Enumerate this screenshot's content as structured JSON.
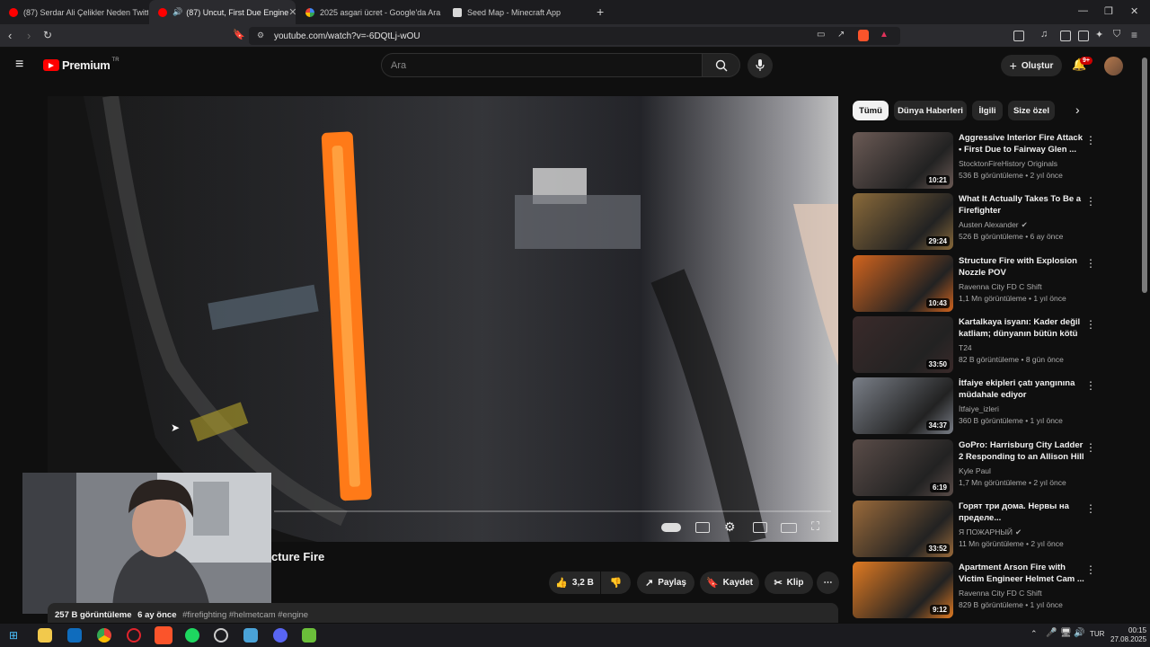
{
  "browser": {
    "tabs": [
      {
        "label": "(87) Serdar Ali Çelikler Neden Twitter",
        "active": false
      },
      {
        "label": "(87) Uncut, First Due Engine",
        "active": true
      },
      {
        "label": "2025 asgari ücret - Google'da Ara",
        "active": false
      },
      {
        "label": "Seed Map - Minecraft App",
        "active": false
      }
    ],
    "url": "youtube.com/watch?v=-6DQtLj-wOU"
  },
  "youtube": {
    "logo_text": "Premium",
    "logo_region": "TR",
    "search_placeholder": "Ara",
    "create_label": "Oluştur",
    "notification_count": "9+"
  },
  "video": {
    "title_visible": "cture Fire",
    "likes": "3,2 B",
    "actions": {
      "share": "Paylaş",
      "save": "Kaydet",
      "clip": "Klip"
    },
    "description": {
      "views": "257 B görüntüleme",
      "age": "6 ay önce",
      "tags": "#firefighting #helmetcam #engine"
    }
  },
  "chips": [
    "Tümü",
    "Dünya Haberleri",
    "İlgili",
    "Size özel"
  ],
  "recommendations": [
    {
      "title": "Aggressive Interior Fire Attack • First Due to Fairway Glen ...",
      "channel": "StocktonFireHistory Originals",
      "verified": false,
      "views": "536 B görüntüleme",
      "age": "2 yıl önce",
      "duration": "10:21",
      "thumb": "#6b5a55"
    },
    {
      "title": "What It Actually Takes To Be a Firefighter",
      "channel": "Austen Alexander",
      "verified": true,
      "views": "526 B görüntüleme",
      "age": "6 ay önce",
      "duration": "29:24",
      "thumb": "#8a6a3a"
    },
    {
      "title": "Structure Fire with Explosion Nozzle POV",
      "channel": "Ravenna City FD C Shift",
      "verified": false,
      "views": "1,1 Mn görüntüleme",
      "age": "1 yıl önce",
      "duration": "10:43",
      "thumb": "#d2641e"
    },
    {
      "title": "Kartalkaya isyanı: Kader değil katliam; dünyanın bütün kötü ...",
      "channel": "T24",
      "verified": false,
      "views": "82 B görüntüleme",
      "age": "8 gün önce",
      "duration": "33:50",
      "thumb": "#3a2a2a"
    },
    {
      "title": "İtfaiye ekipleri çatı yangınına müdahale ediyor",
      "channel": "İtfaiye_izleri",
      "verified": false,
      "views": "360 B görüntüleme",
      "age": "1 yıl önce",
      "duration": "34:37",
      "thumb": "#7a7f88"
    },
    {
      "title": "GoPro: Harrisburg City Ladder 2 Responding to an Allison Hill ...",
      "channel": "Kyle Paul",
      "verified": false,
      "views": "1,7 Mn görüntüleme",
      "age": "2 yıl önce",
      "duration": "6:19",
      "thumb": "#5a4c48"
    },
    {
      "title": "Горят три дома. Нервы на пределе...",
      "channel": "Я ПОЖАРНЫЙ",
      "verified": true,
      "views": "11 Mn görüntüleme",
      "age": "2 yıl önce",
      "duration": "33:52",
      "thumb": "#9a6a3a"
    },
    {
      "title": "Apartment Arson Fire with Victim Engineer Helmet Cam ...",
      "channel": "Ravenna City FD C Shift",
      "verified": false,
      "views": "829 B görüntüleme",
      "age": "1 yıl önce",
      "duration": "9:12",
      "thumb": "#e07a22"
    }
  ],
  "taskbar": {
    "language": "TUR",
    "time": "00:15",
    "date": "27.08.2025"
  }
}
